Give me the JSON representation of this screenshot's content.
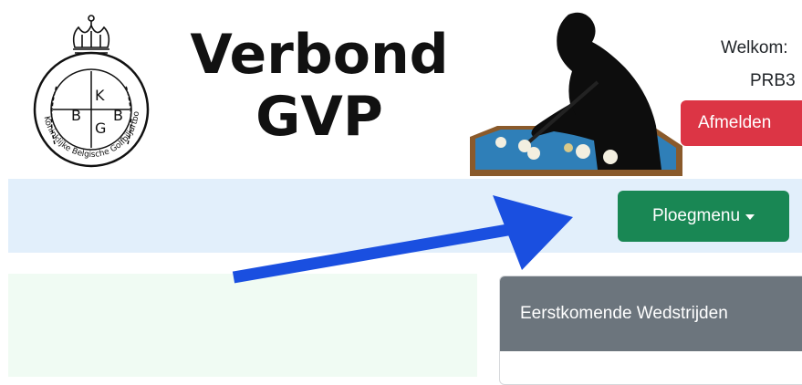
{
  "header": {
    "title_line1": "Verbond",
    "title_line2": "GVP",
    "logo": {
      "name": "kbgb-crest-logo",
      "ring_text": "Koninklijke Belgische Golfbiljartbond",
      "letters": [
        "B",
        "K",
        "G",
        "B"
      ]
    },
    "photo": "billiards-player-silhouette"
  },
  "user": {
    "welcome": "Welkom:",
    "username": "PRB3",
    "logout_label": "Afmelden"
  },
  "nav": {
    "team_menu_label": "Ploegmenu"
  },
  "main": {
    "upcoming_title": "Eerstkomende Wedstrijden"
  },
  "colors": {
    "danger": "#dc3545",
    "success": "#198754",
    "navbar_bg": "#e2effb",
    "card_header": "#6c757d",
    "annotation_arrow": "#1a4fe0"
  },
  "icons": [
    "dropdown-caret-icon",
    "annotation-arrow"
  ]
}
